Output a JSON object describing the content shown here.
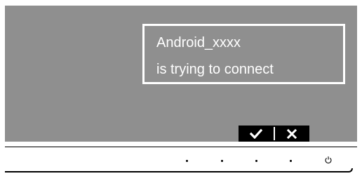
{
  "notification": {
    "device_name": "Android_xxxx",
    "message": "is trying to connect"
  },
  "dialog_buttons": {
    "accept_icon": "checkmark-icon",
    "reject_icon": "close-icon"
  },
  "hardware_keys": {
    "keys": [
      "dot-key",
      "dot-key",
      "dot-key",
      "dot-key",
      "power-icon"
    ]
  },
  "colors": {
    "screen": "#8f8f8f",
    "notice_border": "#ffffff",
    "button_bar": "#000000"
  }
}
